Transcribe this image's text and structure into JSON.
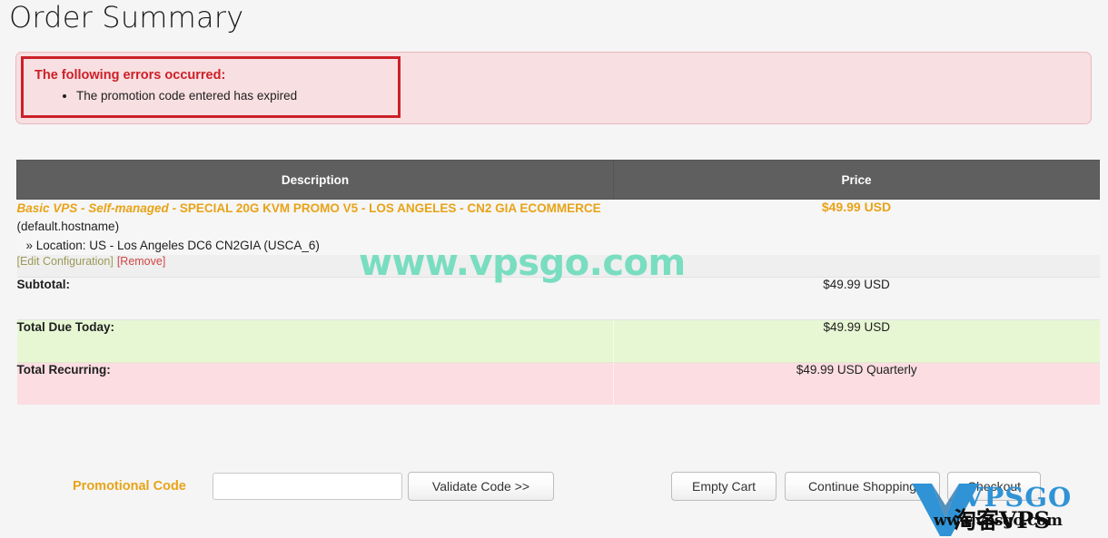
{
  "page": {
    "title": "Order Summary",
    "background_color": "#f5f5f5"
  },
  "error_panel": {
    "heading": "The following errors occurred:",
    "messages": [
      "The promotion code entered has expired"
    ],
    "border_color": "#cc2028",
    "background_color": "#f8dfe1"
  },
  "order_table": {
    "headers": {
      "description": "Description",
      "price": "Price"
    },
    "header_background": "#5f5f5f",
    "product": {
      "name_italic": "Basic VPS - Self-managed",
      "name_separator": " - ",
      "name_bold": "SPECIAL 20G KVM PROMO V5 - LOS ANGELES - CN2 GIA ECOMMERCE",
      "hostname": " (default.hostname)",
      "location": "» Location: US - Los Angeles DC6 CN2GIA (USCA_6)",
      "price": "$49.99 USD",
      "price_color": "#e8a317"
    },
    "actions": {
      "edit_label": "[Edit Configuration]",
      "remove_label": "[Remove]",
      "edit_color": "#9a9a57",
      "remove_color": "#d14545"
    },
    "summary_rows": [
      {
        "label": "Subtotal:",
        "value": "$49.99 USD",
        "row_color": "#f5f5f5"
      },
      {
        "label": "Total Due Today:",
        "value": "$49.99 USD",
        "row_color": "#e7f7d4"
      },
      {
        "label": "Total Recurring:",
        "value": "$49.99 USD Quarterly",
        "row_color": "#fbdde2"
      }
    ]
  },
  "bottom_bar": {
    "promo_label": "Promotional Code",
    "promo_label_color": "#e8a317",
    "promo_input_value": "",
    "promo_input_placeholder": "",
    "validate_button": "Validate Code >>",
    "empty_cart_button": "Empty Cart",
    "continue_shopping_button": "Continue Shopping",
    "checkout_button": "Checkout"
  },
  "watermarks": {
    "center_text": "www.vpsgo.com",
    "center_color": "#79ddc0",
    "logo_name": "VPSGO",
    "logo_url": "www.vpsgo.com",
    "logo_cn": "淘客VPS",
    "logo_color": "#2f93d6"
  }
}
